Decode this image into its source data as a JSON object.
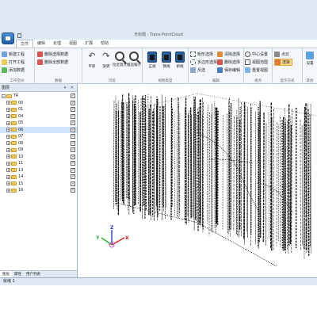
{
  "window": {
    "title": "无标题 - Trans-PointCloud"
  },
  "tabs": [
    "文件",
    "编辑",
    "处理",
    "视图",
    "扩展",
    "帮助"
  ],
  "ribbon": {
    "groups": [
      {
        "label": "工作空间",
        "items": [
          "新建工程",
          "打开工程",
          "添加数据"
        ]
      },
      {
        "label": "数据",
        "items": [
          "删除选择数据",
          "删除全部数据"
        ]
      },
      {
        "label": "浏览",
        "items": [
          "平移",
          "旋转",
          "拉近放大",
          "推远缩小"
        ]
      },
      {
        "label": "视图类型",
        "items": [
          "正视",
          "侧视",
          "俯视"
        ]
      },
      {
        "label": "编辑",
        "items": [
          "矩形选择",
          "多边形选择",
          "反选",
          "清除选择",
          "删除选择",
          "保存编辑"
        ]
      },
      {
        "label": "视点",
        "items": [
          "中心设置",
          "视图范围",
          "重置视图"
        ]
      },
      {
        "label": "显示方式",
        "items": [
          "点云",
          "渲染"
        ]
      },
      {
        "label": "其他",
        "items": [
          "设置"
        ]
      }
    ]
  },
  "left_panel": {
    "title": "图层",
    "root": "TA",
    "items": [
      "00",
      "01",
      "04",
      "05",
      "06",
      "07",
      "08",
      "09",
      "10",
      "11",
      "13",
      "14",
      "15",
      "16"
    ],
    "selected": "06",
    "tabs": [
      "图层",
      "属性",
      "用户列表"
    ]
  },
  "viewport": {
    "axes": [
      "X",
      "Y",
      "Z"
    ],
    "axis_colors": {
      "x": "#e52020",
      "y": "#20b020",
      "z": "#2040e0"
    }
  },
  "status": {
    "text": "就绪 1"
  }
}
